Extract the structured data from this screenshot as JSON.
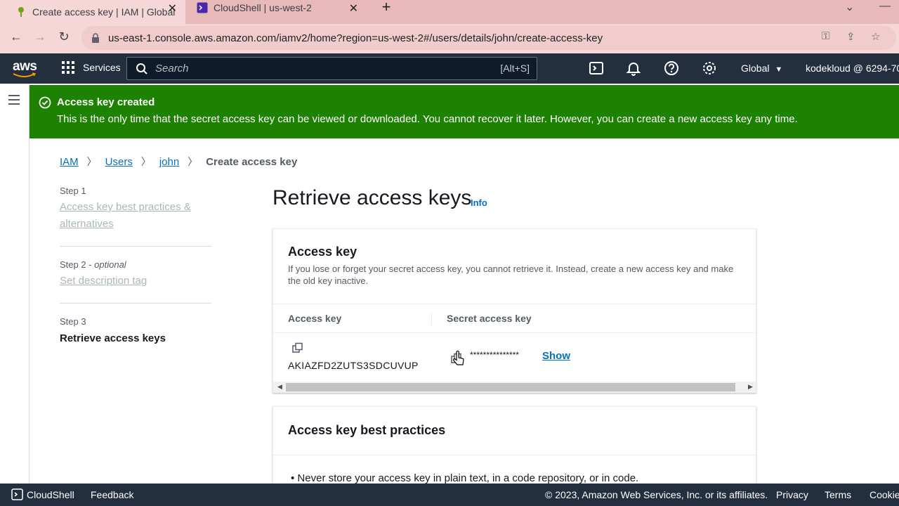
{
  "browser": {
    "tabs": [
      {
        "title": "Create access key | IAM | Global",
        "icon": "aws-iam-favicon-icon"
      },
      {
        "title": "CloudShell | us-west-2",
        "icon": "cloudshell-favicon-icon"
      }
    ],
    "url": "us-east-1.console.aws.amazon.com/iamv2/home?region=us-west-2#/users/details/john/create-access-key"
  },
  "aws_nav": {
    "logo": "aws",
    "services_label": "Services",
    "search_placeholder": "Search",
    "search_shortcut": "[Alt+S]",
    "region_label": "Global",
    "account_label": "kodekloud @ 6294-70"
  },
  "flash": {
    "title": "Access key created",
    "message": "This is the only time that the secret access key can be viewed or downloaded. You cannot recover it later. However, you can create a new access key any time."
  },
  "breadcrumb": {
    "items": [
      "IAM",
      "Users",
      "john"
    ],
    "current": "Create access key"
  },
  "steps": [
    {
      "label": "Step 1",
      "name": "Access key best practices & alternatives"
    },
    {
      "label": "Step 2",
      "optional": "optional",
      "name": "Set description tag"
    },
    {
      "label": "Step 3",
      "name": "Retrieve access keys"
    }
  ],
  "main": {
    "title": "Retrieve access keys",
    "info_link": "Info"
  },
  "access_key_panel": {
    "title": "Access key",
    "description": "If you lose or forget your secret access key, you cannot retrieve it. Instead, create a new access key and make the old key inactive.",
    "col_access_key": "Access key",
    "col_secret": "Secret access key",
    "access_key_value": "AKIAZFD2ZUTS3SDCUVUP",
    "secret_masked": "***************",
    "show_label": "Show"
  },
  "best_practices_panel": {
    "title": "Access key best practices",
    "bullet_1": "Never store your access key in plain text, in a code repository, or in code."
  },
  "footer": {
    "cloudshell": "CloudShell",
    "feedback": "Feedback",
    "copyright": "© 2023, Amazon Web Services, Inc. or its affiliates.",
    "privacy": "Privacy",
    "terms": "Terms",
    "cookie": "Cookie"
  },
  "colors": {
    "flash_success": "#1d8102",
    "aws_nav_bg": "#232f3e",
    "link": "#0073bb"
  }
}
